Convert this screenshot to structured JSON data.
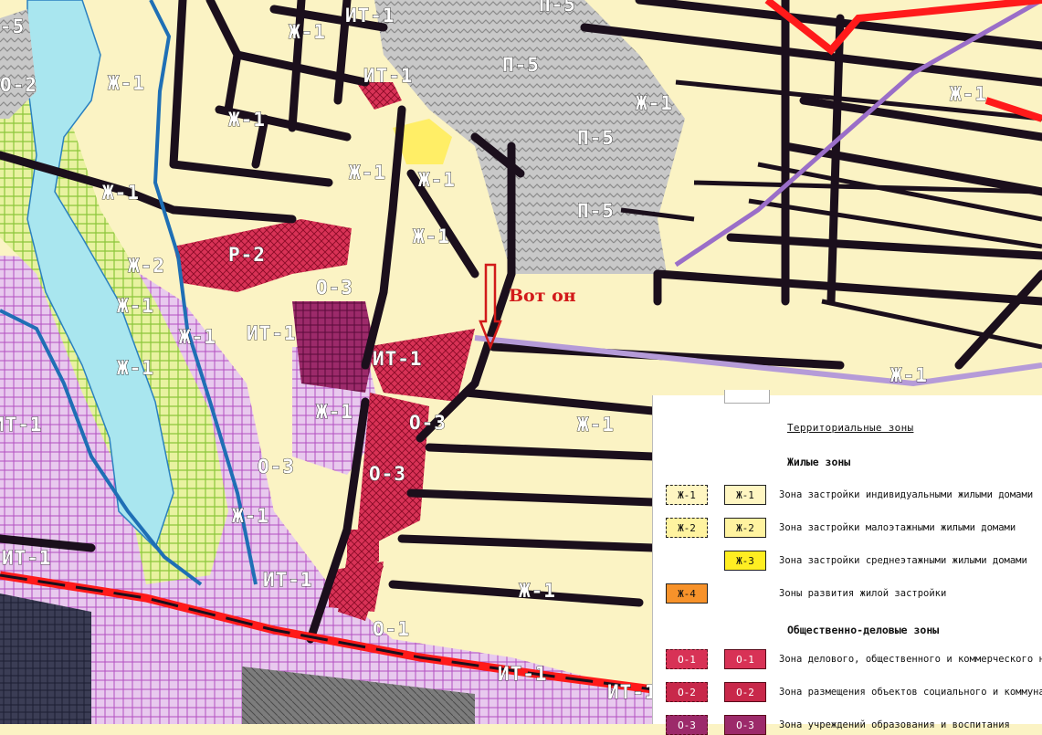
{
  "map": {
    "zone_labels": [
      {
        "id": "p5-a",
        "text": "П-5"
      },
      {
        "id": "p5-b",
        "text": "П-5"
      },
      {
        "id": "p5-c",
        "text": "П-5"
      },
      {
        "id": "p5-d",
        "text": "П-5"
      },
      {
        "id": "it1-a",
        "text": "ИТ-1"
      },
      {
        "id": "it1-b",
        "text": "ИТ-1"
      },
      {
        "id": "it1-c",
        "text": "ИТ-1"
      },
      {
        "id": "it1-d",
        "text": "ИТ-1"
      },
      {
        "id": "it1-e",
        "text": "ИТ-1"
      },
      {
        "id": "it1-f",
        "text": "ИТ-1"
      },
      {
        "id": "it1-g",
        "text": "ИТ-1"
      },
      {
        "id": "it1-h",
        "text": "ИТ-1"
      },
      {
        "id": "it1-i",
        "text": "ИТ-1"
      },
      {
        "id": "zh1-a",
        "text": "Ж-1"
      },
      {
        "id": "zh1-b",
        "text": "Ж-1"
      },
      {
        "id": "zh1-c",
        "text": "Ж-1"
      },
      {
        "id": "zh1-d",
        "text": "Ж-1"
      },
      {
        "id": "zh1-e",
        "text": "Ж-1"
      },
      {
        "id": "zh1-f",
        "text": "Ж-1"
      },
      {
        "id": "zh1-g",
        "text": "Ж-1"
      },
      {
        "id": "zh1-h",
        "text": "Ж-1"
      },
      {
        "id": "zh1-i",
        "text": "Ж-1"
      },
      {
        "id": "zh1-j",
        "text": "Ж-1"
      },
      {
        "id": "zh1-k",
        "text": "Ж-1"
      },
      {
        "id": "zh1-l",
        "text": "Ж-1"
      },
      {
        "id": "zh1-m",
        "text": "Ж-1"
      },
      {
        "id": "zh1-n",
        "text": "Ж-1"
      },
      {
        "id": "zh1-o",
        "text": "Ж-1"
      },
      {
        "id": "zh1-p",
        "text": "Ж-1"
      },
      {
        "id": "zh1-q",
        "text": "Ж-1"
      },
      {
        "id": "zh2-a",
        "text": "Ж-2"
      },
      {
        "id": "r2-a",
        "text": "Р-2"
      },
      {
        "id": "o3-a",
        "text": "О-3"
      },
      {
        "id": "o3-b",
        "text": "О-3"
      },
      {
        "id": "o3-c",
        "text": "О-3"
      },
      {
        "id": "o3-d",
        "text": "О-3"
      },
      {
        "id": "o1-a",
        "text": "О-1"
      },
      {
        "id": "o2-a",
        "text": "О-2"
      },
      {
        "id": "s5-a",
        "text": "-5"
      },
      {
        "id": "p-a",
        "text": "П-5"
      }
    ],
    "callout": "Вот он",
    "colors": {
      "residential": "#fbf3c4",
      "industrial": "#c9c9c9",
      "public": "#d83256",
      "recreation_water": "#a9e6ef",
      "infrastructure": "#e7c8ec",
      "road": "#1b0f1c",
      "red_line": "#ff1a1a",
      "arrow": "#d21a1a"
    }
  },
  "legend": {
    "title": "Территориальные зоны",
    "sections": [
      {
        "heading": "Жилые зоны",
        "rows": [
          {
            "sw1": "Ж-1",
            "sw2": "Ж-1",
            "desc": "Зона застройки индивидуальными жилыми домами"
          },
          {
            "sw1": "Ж-2",
            "sw2": "Ж-2",
            "desc": "Зона застройки малоэтажными жилыми домами"
          },
          {
            "sw1": "",
            "sw2": "Ж-3",
            "desc": "Зона застройки среднеэтажными жилыми домами"
          },
          {
            "sw1": "Ж-4",
            "sw2": "",
            "desc": "Зоны развития жилой застройки"
          }
        ]
      },
      {
        "heading": "Общественно-деловые зоны",
        "rows": [
          {
            "sw1": "О-1",
            "sw2": "О-1",
            "desc": "Зона делового, общественного и коммерческого назн"
          },
          {
            "sw1": "О-2",
            "sw2": "О-2",
            "desc": "Зона размещения объектов социального и коммунальн"
          },
          {
            "sw1": "О-3",
            "sw2": "О-3",
            "desc": "Зона учреждений образования и воспитания"
          }
        ]
      }
    ]
  }
}
